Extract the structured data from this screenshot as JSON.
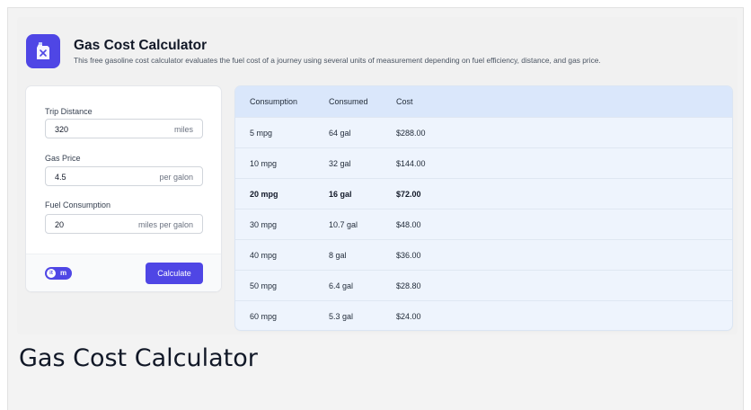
{
  "header": {
    "title": "Gas Cost Calculator",
    "subtitle": "This free gasoline cost calculator evaluates the fuel cost of a journey using several units of measurement depending on fuel efficiency, distance, and gas price.",
    "icon": "fuel-can-icon",
    "accent_color": "#4f46e5"
  },
  "form": {
    "trip_distance": {
      "label": "Trip Distance",
      "value": "320",
      "unit": "miles"
    },
    "gas_price": {
      "label": "Gas Price",
      "value": "4.5",
      "unit": "per galon"
    },
    "fuel_consumption": {
      "label": "Fuel Consumption",
      "value": "20",
      "unit": "miles per galon"
    },
    "unit_toggle": {
      "left": "it",
      "right": "m"
    },
    "calculate_label": "Calculate"
  },
  "table": {
    "columns": [
      "Consumption",
      "Consumed",
      "Cost"
    ],
    "rows": [
      {
        "consumption": "5 mpg",
        "consumed": "64 gal",
        "cost": "$288.00",
        "highlight": false
      },
      {
        "consumption": "10 mpg",
        "consumed": "32 gal",
        "cost": "$144.00",
        "highlight": false
      },
      {
        "consumption": "20 mpg",
        "consumed": "16 gal",
        "cost": "$72.00",
        "highlight": true
      },
      {
        "consumption": "30 mpg",
        "consumed": "10.7 gal",
        "cost": "$48.00",
        "highlight": false
      },
      {
        "consumption": "40 mpg",
        "consumed": "8 gal",
        "cost": "$36.00",
        "highlight": false
      },
      {
        "consumption": "50 mpg",
        "consumed": "6.4 gal",
        "cost": "$28.80",
        "highlight": false
      },
      {
        "consumption": "60 mpg",
        "consumed": "5.3 gal",
        "cost": "$24.00",
        "highlight": false
      }
    ]
  },
  "caption": "Gas Cost Calculator"
}
